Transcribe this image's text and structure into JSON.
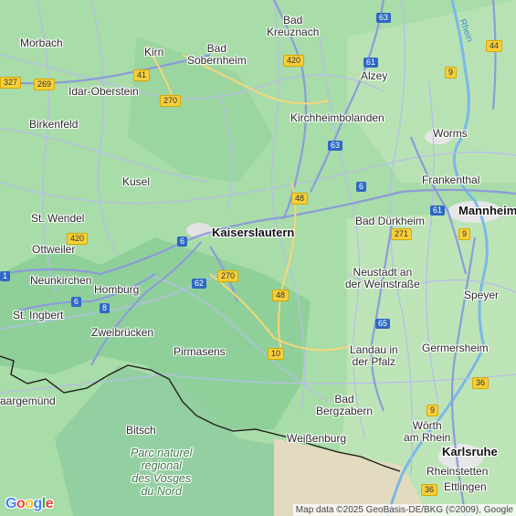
{
  "map": {
    "colors": {
      "land": "#a8dca8",
      "forest": "#8fd09a",
      "urban": "#e6e6e6",
      "water": "#7ab8e8",
      "road_a": "#8d9bd9",
      "border": "#222222"
    },
    "places": [
      {
        "id": "bad-kreuznach",
        "label": "Bad\nKreuznach"
      },
      {
        "id": "morbach",
        "label": "Morbach"
      },
      {
        "id": "kirn",
        "label": "Kirn"
      },
      {
        "id": "bad-sobernheim",
        "label": "Bad\nSobernheim"
      },
      {
        "id": "alzey",
        "label": "Alzey"
      },
      {
        "id": "idar-oberstein",
        "label": "Idar-Oberstein"
      },
      {
        "id": "birkenfeld",
        "label": "Birkenfeld"
      },
      {
        "id": "kirchheimbolanden",
        "label": "Kirchheimbolanden"
      },
      {
        "id": "worms",
        "label": "Worms"
      },
      {
        "id": "kusel",
        "label": "Kusel"
      },
      {
        "id": "frankenthal",
        "label": "Frankenthal"
      },
      {
        "id": "st-wendel",
        "label": "St. Wendel"
      },
      {
        "id": "kaiserslautern",
        "label": "Kaiserslautern"
      },
      {
        "id": "bad-durkheim",
        "label": "Bad Dürkheim"
      },
      {
        "id": "mannheim",
        "label": "Mannheim"
      },
      {
        "id": "ottweiler",
        "label": "Ottweiler"
      },
      {
        "id": "neunkirchen",
        "label": "Neunkirchen"
      },
      {
        "id": "homburg",
        "label": "Homburg"
      },
      {
        "id": "neustadt",
        "label": "Neustadt an\nder Weinstraße"
      },
      {
        "id": "speyer",
        "label": "Speyer"
      },
      {
        "id": "st-ingbert",
        "label": "St. Ingbert"
      },
      {
        "id": "zweibrucken",
        "label": "Zweibrücken"
      },
      {
        "id": "pirmasens",
        "label": "Pirmasens"
      },
      {
        "id": "landau",
        "label": "Landau in\nder Pfalz"
      },
      {
        "id": "germersheim",
        "label": "Germersheim"
      },
      {
        "id": "saargemund",
        "label": "aargemünd"
      },
      {
        "id": "bad-bergzabern",
        "label": "Bad\nBergzabern"
      },
      {
        "id": "bitsch",
        "label": "Bitsch"
      },
      {
        "id": "worth",
        "label": "Wörth\nam Rhein"
      },
      {
        "id": "karlsruhe",
        "label": "Karlsruhe"
      },
      {
        "id": "weissenburg",
        "label": "Weißenburg"
      },
      {
        "id": "rheinstetten",
        "label": "Rheinstetten"
      },
      {
        "id": "ettlingen",
        "label": "Ettlingen"
      }
    ],
    "park": "Parc naturel\nrégional\ndes Vosges\ndu Nord",
    "river": "Rhein",
    "shields": [
      "63",
      "44",
      "420",
      "61",
      "9",
      "327",
      "269",
      "41",
      "270",
      "63",
      "6",
      "48",
      "61",
      "6",
      "9",
      "420",
      "271",
      "1",
      "6",
      "62",
      "270",
      "8",
      "48",
      "65",
      "10",
      "36",
      "9",
      "36"
    ],
    "attribution": "Map data ©2025 GeoBasis-DE/BKG (©2009), Google",
    "logo": [
      "G",
      "o",
      "o",
      "g",
      "l",
      "e"
    ]
  }
}
